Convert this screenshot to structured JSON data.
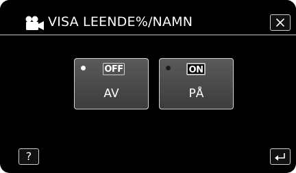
{
  "header": {
    "title": "VISA LEENDE%/NAMN",
    "mode_icon": "video-camera-icon"
  },
  "controls": {
    "close_icon": "close-icon",
    "help_label": "?",
    "back_icon": "return-arrow-icon"
  },
  "options": [
    {
      "badge": "OFF",
      "label": "AV",
      "indicator": "white-dot"
    },
    {
      "badge": "ON",
      "label": "PÅ",
      "indicator": "black-dot"
    }
  ],
  "colors": {
    "background": "#000000",
    "option_fill": "#4a4a4a",
    "border": "#d6d6d6",
    "text": "#ffffff"
  }
}
